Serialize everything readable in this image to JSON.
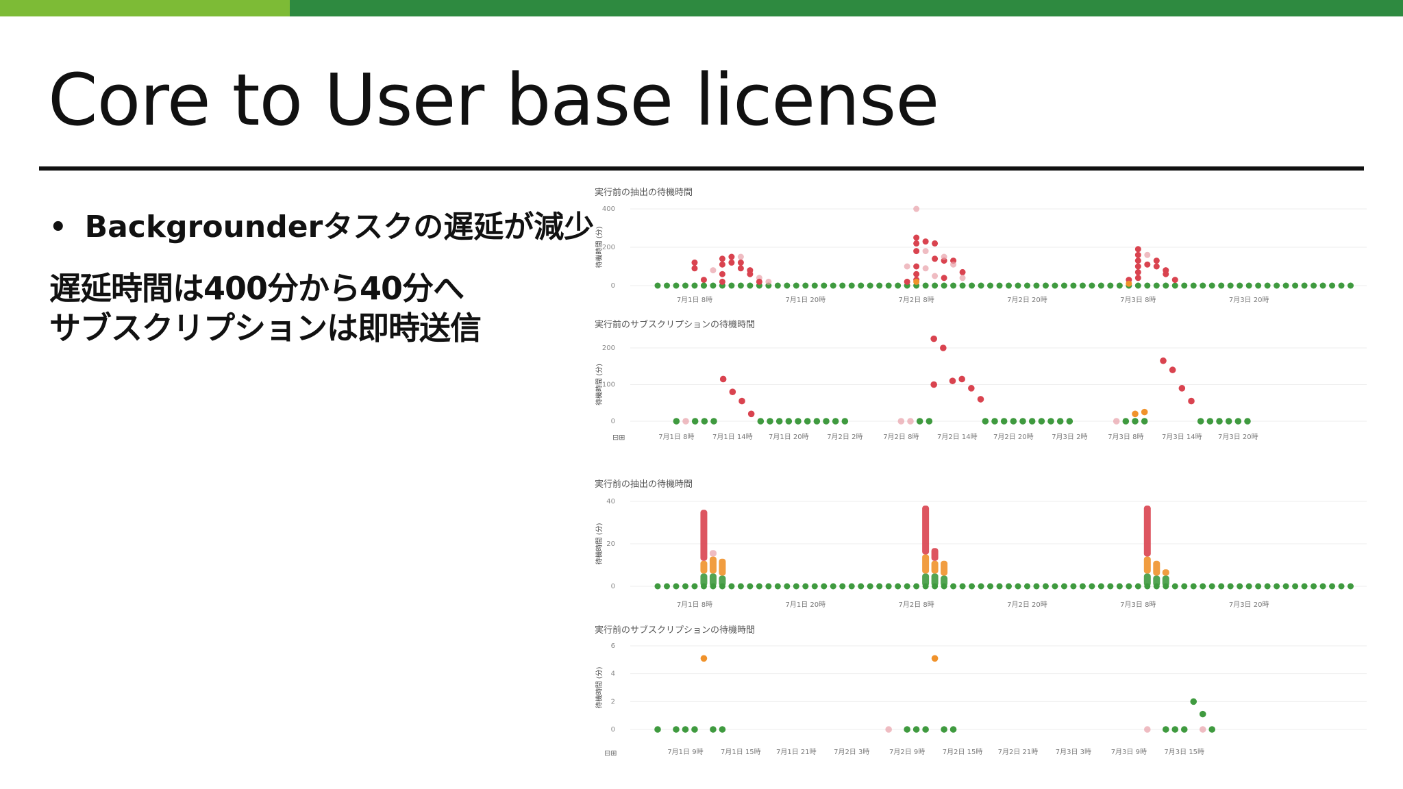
{
  "slide": {
    "title": "Core to User base license",
    "bullet": "Backgrounderタスクの遅延が減少",
    "lines": [
      "遅延時間は400分から40分へ",
      "サブスクリプションは即時送信"
    ]
  },
  "theme": {
    "accent_light": "#7dbb36",
    "accent_dark": "#2e8a40",
    "ok": "#3f9a3f",
    "warn": "#f0922b",
    "bad": "#d9434f"
  },
  "chart_data": [
    {
      "type": "scatter",
      "title": "実行前の抽出の待機時間",
      "ylabel": "待機時間 (分)",
      "yticks": [
        0,
        200,
        400
      ],
      "ylim": [
        0,
        400
      ],
      "xlim": [
        4,
        80
      ],
      "xticks": [
        {
          "x": 8,
          "label": "7月1日 8時"
        },
        {
          "x": 20,
          "label": "7月1日 20時"
        },
        {
          "x": 32,
          "label": "7月2日 8時"
        },
        {
          "x": 44,
          "label": "7月2日 20時"
        },
        {
          "x": 56,
          "label": "7月3日 8時"
        },
        {
          "x": 68,
          "label": "7月3日 20時"
        }
      ],
      "x_step": 1,
      "baseline": {
        "from": 4,
        "to": 79.5,
        "value": 0
      },
      "points": [
        [
          8,
          120,
          "bad"
        ],
        [
          8,
          90,
          "bad"
        ],
        [
          9,
          30,
          "bad"
        ],
        [
          9,
          0,
          "ok"
        ],
        [
          10,
          80,
          "faint"
        ],
        [
          11,
          140,
          "bad"
        ],
        [
          11,
          110,
          "bad"
        ],
        [
          11,
          60,
          "bad"
        ],
        [
          11,
          20,
          "bad"
        ],
        [
          12,
          150,
          "bad"
        ],
        [
          12,
          120,
          "bad"
        ],
        [
          13,
          150,
          "faint"
        ],
        [
          13,
          120,
          "bad"
        ],
        [
          13,
          90,
          "bad"
        ],
        [
          14,
          80,
          "bad"
        ],
        [
          14,
          60,
          "bad"
        ],
        [
          15,
          40,
          "faint"
        ],
        [
          15,
          20,
          "bad"
        ],
        [
          16,
          20,
          "faint"
        ],
        [
          31,
          20,
          "bad"
        ],
        [
          32,
          250,
          "bad"
        ],
        [
          32,
          220,
          "bad"
        ],
        [
          32,
          180,
          "bad"
        ],
        [
          32,
          100,
          "bad"
        ],
        [
          32,
          60,
          "bad"
        ],
        [
          32,
          30,
          "bad"
        ],
        [
          31,
          100,
          "faint"
        ],
        [
          33,
          230,
          "bad"
        ],
        [
          33,
          180,
          "faint"
        ],
        [
          33,
          90,
          "faint"
        ],
        [
          34,
          220,
          "bad"
        ],
        [
          34,
          140,
          "bad"
        ],
        [
          34,
          50,
          "faint"
        ],
        [
          35,
          130,
          "bad"
        ],
        [
          35,
          150,
          "faint"
        ],
        [
          35,
          40,
          "bad"
        ],
        [
          36,
          130,
          "bad"
        ],
        [
          36,
          110,
          "faint"
        ],
        [
          37,
          70,
          "bad"
        ],
        [
          37,
          40,
          "faint"
        ],
        [
          32,
          400,
          "faint"
        ],
        [
          32,
          20,
          "warn"
        ],
        [
          55,
          30,
          "bad"
        ],
        [
          56,
          190,
          "bad"
        ],
        [
          56,
          160,
          "bad"
        ],
        [
          56,
          130,
          "bad"
        ],
        [
          56,
          100,
          "bad"
        ],
        [
          56,
          70,
          "bad"
        ],
        [
          56,
          40,
          "bad"
        ],
        [
          57,
          160,
          "faint"
        ],
        [
          57,
          110,
          "bad"
        ],
        [
          58,
          130,
          "bad"
        ],
        [
          58,
          100,
          "bad"
        ],
        [
          59,
          80,
          "bad"
        ],
        [
          59,
          60,
          "bad"
        ],
        [
          60,
          30,
          "bad"
        ],
        [
          55,
          10,
          "warn"
        ]
      ]
    },
    {
      "type": "scatter",
      "title": "実行前のサブスクリプションの待機時間",
      "ylabel": "待機時間 (分)",
      "yticks": [
        0,
        100,
        200
      ],
      "ylim": [
        0,
        200
      ],
      "xlim": [
        4,
        79
      ],
      "xticks": [
        {
          "x": 6,
          "label": "7月1日 8時"
        },
        {
          "x": 12,
          "label": "7月1日 14時"
        },
        {
          "x": 18,
          "label": "7月1日 20時"
        },
        {
          "x": 24,
          "label": "7月2日 2時"
        },
        {
          "x": 30,
          "label": "7月2日 8時"
        },
        {
          "x": 36,
          "label": "7月2日 14時"
        },
        {
          "x": 42,
          "label": "7月2日 20時"
        },
        {
          "x": 48,
          "label": "7月3日 2時"
        },
        {
          "x": 54,
          "label": "7月3日 8時"
        },
        {
          "x": 60,
          "label": "7月3日 14時"
        },
        {
          "x": 66,
          "label": "7月3日 20時"
        }
      ],
      "points": [
        [
          6,
          0,
          "ok"
        ],
        [
          7,
          0,
          "faint"
        ],
        [
          8,
          0,
          "ok"
        ],
        [
          9,
          0,
          "ok"
        ],
        [
          10,
          0,
          "ok"
        ],
        [
          11,
          115,
          "bad"
        ],
        [
          12,
          80,
          "bad"
        ],
        [
          13,
          55,
          "bad"
        ],
        [
          14,
          20,
          "bad"
        ],
        [
          15,
          0,
          "ok"
        ],
        [
          16,
          0,
          "ok"
        ],
        [
          17,
          0,
          "ok"
        ],
        [
          18,
          0,
          "ok"
        ],
        [
          19,
          0,
          "ok"
        ],
        [
          20,
          0,
          "ok"
        ],
        [
          21,
          0,
          "ok"
        ],
        [
          22,
          0,
          "ok"
        ],
        [
          23,
          0,
          "ok"
        ],
        [
          24,
          0,
          "ok"
        ],
        [
          30,
          0,
          "faint"
        ],
        [
          31,
          0,
          "faint"
        ],
        [
          32,
          0,
          "ok"
        ],
        [
          33,
          0,
          "ok"
        ],
        [
          33.5,
          225,
          "bad"
        ],
        [
          34.5,
          200,
          "bad"
        ],
        [
          33.5,
          100,
          "bad"
        ],
        [
          35.5,
          110,
          "bad"
        ],
        [
          36.5,
          115,
          "bad"
        ],
        [
          37.5,
          90,
          "bad"
        ],
        [
          38.5,
          60,
          "bad"
        ],
        [
          39,
          0,
          "ok"
        ],
        [
          40,
          0,
          "ok"
        ],
        [
          41,
          0,
          "ok"
        ],
        [
          42,
          0,
          "ok"
        ],
        [
          43,
          0,
          "ok"
        ],
        [
          44,
          0,
          "ok"
        ],
        [
          45,
          0,
          "ok"
        ],
        [
          46,
          0,
          "ok"
        ],
        [
          47,
          0,
          "ok"
        ],
        [
          48,
          0,
          "ok"
        ],
        [
          53,
          0,
          "faint"
        ],
        [
          54,
          0,
          "ok"
        ],
        [
          55,
          0,
          "ok"
        ],
        [
          56,
          0,
          "ok"
        ],
        [
          55,
          20,
          "warn"
        ],
        [
          56,
          25,
          "warn"
        ],
        [
          58,
          165,
          "bad"
        ],
        [
          59,
          140,
          "bad"
        ],
        [
          60,
          90,
          "bad"
        ],
        [
          61,
          55,
          "bad"
        ],
        [
          62,
          0,
          "ok"
        ],
        [
          63,
          0,
          "ok"
        ],
        [
          64,
          0,
          "ok"
        ],
        [
          65,
          0,
          "ok"
        ],
        [
          66,
          0,
          "ok"
        ],
        [
          67,
          0,
          "ok"
        ]
      ]
    },
    {
      "type": "scatter",
      "title": "実行前の抽出の待機時間",
      "ylabel": "待機時間 (分)",
      "yticks": [
        0,
        20,
        40
      ],
      "ylim": [
        0,
        40
      ],
      "xlim": [
        4,
        80
      ],
      "xticks": [
        {
          "x": 8,
          "label": "7月1日 8時"
        },
        {
          "x": 20,
          "label": "7月1日 20時"
        },
        {
          "x": 32,
          "label": "7月2日 8時"
        },
        {
          "x": 44,
          "label": "7月2日 20時"
        },
        {
          "x": 56,
          "label": "7月3日 8時"
        },
        {
          "x": 68,
          "label": "7月3日 20時"
        }
      ],
      "baseline": {
        "from": 4,
        "to": 79.5,
        "value": 0
      },
      "spikes": [
        {
          "x": 9,
          "stack": [
            [
              "ok",
              0,
              6
            ],
            [
              "warn",
              6,
              12
            ],
            [
              "bad",
              12,
              36
            ]
          ]
        },
        {
          "x": 10,
          "stack": [
            [
              "ok",
              0,
              6
            ],
            [
              "warn",
              6,
              14
            ],
            [
              "faint",
              14,
              17
            ]
          ]
        },
        {
          "x": 11,
          "stack": [
            [
              "ok",
              0,
              5
            ],
            [
              "warn",
              5,
              13
            ]
          ]
        },
        {
          "x": 33,
          "stack": [
            [
              "ok",
              0,
              6
            ],
            [
              "warn",
              6,
              15
            ],
            [
              "bad",
              15,
              38
            ]
          ]
        },
        {
          "x": 34,
          "stack": [
            [
              "ok",
              0,
              6
            ],
            [
              "warn",
              6,
              12
            ],
            [
              "bad",
              12,
              18
            ]
          ]
        },
        {
          "x": 35,
          "stack": [
            [
              "ok",
              0,
              5
            ],
            [
              "warn",
              5,
              12
            ]
          ]
        },
        {
          "x": 57,
          "stack": [
            [
              "ok",
              0,
              6
            ],
            [
              "warn",
              6,
              14
            ],
            [
              "bad",
              14,
              38
            ]
          ]
        },
        {
          "x": 58,
          "stack": [
            [
              "ok",
              0,
              5
            ],
            [
              "warn",
              5,
              12
            ]
          ]
        },
        {
          "x": 59,
          "stack": [
            [
              "ok",
              0,
              5
            ],
            [
              "warn",
              5,
              8
            ]
          ]
        }
      ]
    },
    {
      "type": "scatter",
      "title": "実行前のサブスクリプションの待機時間",
      "ylabel": "待機時間 (分)",
      "yticks": [
        0,
        2,
        4,
        6
      ],
      "ylim": [
        0,
        6
      ],
      "xlim": [
        6,
        82
      ],
      "xticks": [
        {
          "x": 9,
          "label": "7月1日 9時"
        },
        {
          "x": 15,
          "label": "7月1日 15時"
        },
        {
          "x": 21,
          "label": "7月1日 21時"
        },
        {
          "x": 27,
          "label": "7月2日 3時"
        },
        {
          "x": 33,
          "label": "7月2日 9時"
        },
        {
          "x": 39,
          "label": "7月2日 15時"
        },
        {
          "x": 45,
          "label": "7月2日 21時"
        },
        {
          "x": 51,
          "label": "7月3日 3時"
        },
        {
          "x": 57,
          "label": "7月3日 9時"
        },
        {
          "x": 63,
          "label": "7月3日 15時"
        }
      ],
      "points": [
        [
          6,
          0,
          "ok"
        ],
        [
          8,
          0,
          "ok"
        ],
        [
          9,
          0,
          "ok"
        ],
        [
          10,
          0,
          "ok"
        ],
        [
          11,
          5.1,
          "warn"
        ],
        [
          12,
          0,
          "ok"
        ],
        [
          13,
          0,
          "ok"
        ],
        [
          31,
          0,
          "faint"
        ],
        [
          33,
          0,
          "ok"
        ],
        [
          34,
          0,
          "ok"
        ],
        [
          35,
          0,
          "ok"
        ],
        [
          36,
          5.1,
          "warn"
        ],
        [
          37,
          0,
          "ok"
        ],
        [
          38,
          0,
          "ok"
        ],
        [
          59,
          0,
          "faint"
        ],
        [
          61,
          0,
          "ok"
        ],
        [
          62,
          0,
          "ok"
        ],
        [
          63,
          0,
          "ok"
        ],
        [
          64,
          2,
          "ok"
        ],
        [
          65,
          1.1,
          "ok"
        ],
        [
          65,
          0,
          "faint"
        ],
        [
          66,
          0,
          "ok"
        ]
      ]
    }
  ]
}
